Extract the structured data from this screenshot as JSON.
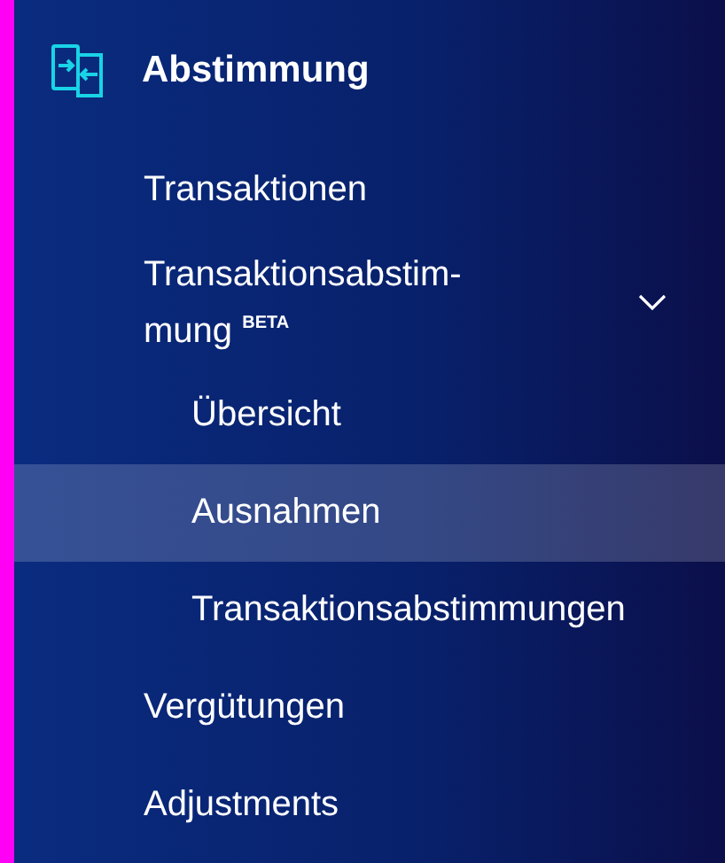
{
  "section": {
    "title": "Abstimmung"
  },
  "items": [
    {
      "kind": "link",
      "label": "Transaktionen",
      "selected": false
    },
    {
      "kind": "group",
      "label_lines": [
        "Transaktionsabstim-",
        "mung"
      ],
      "badge": "BETA",
      "expanded": true,
      "children": [
        {
          "label": "Übersicht",
          "selected": false
        },
        {
          "label": "Ausnahmen",
          "selected": true
        },
        {
          "label": "Transaktionsabstimmungen",
          "selected": false
        }
      ]
    },
    {
      "kind": "link",
      "label": "Vergütungen",
      "selected": false
    },
    {
      "kind": "link",
      "label": "Adjustments",
      "selected": false
    }
  ]
}
